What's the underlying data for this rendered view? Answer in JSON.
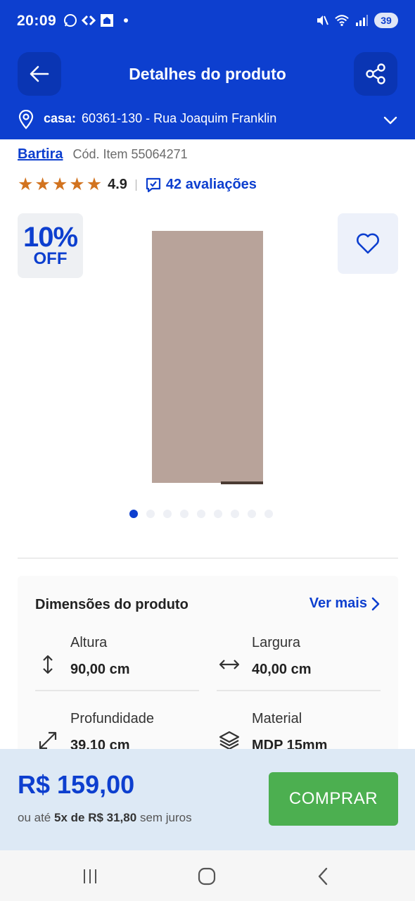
{
  "status_bar": {
    "time": "20:09",
    "battery": "39",
    "icons_left": [
      "whatsapp-icon",
      "carrefour-icon",
      "home-app-icon"
    ],
    "icons_right": [
      "mute-vibrate-icon",
      "wifi-icon",
      "signal-icon",
      "battery-icon"
    ]
  },
  "header": {
    "title": "Detalhes do produto",
    "back_icon": "arrow-left-icon",
    "share_icon": "share-icon"
  },
  "address": {
    "label": "casa:",
    "value": "60361-130 - Rua Joaquim Franklin"
  },
  "product": {
    "brand": "Bartira",
    "item_code": "Cód. Item 55064271",
    "rating": "4.9",
    "stars": 5,
    "reviews": "42 avaliações",
    "discount_pct": "10%",
    "discount_off": "OFF",
    "image_count": 9,
    "image_active": 1,
    "colors": {
      "accent": "#0d3fcf",
      "product": "#b8a39a",
      "buy": "#4caf50",
      "star": "#d2731f"
    }
  },
  "dimensions": {
    "title": "Dimensões do produto",
    "see_more": "Ver mais",
    "items": [
      {
        "label": "Altura",
        "value": "90,00 cm",
        "icon": "height-arrows-icon"
      },
      {
        "label": "Largura",
        "value": "40,00 cm",
        "icon": "width-arrows-icon"
      },
      {
        "label": "Profundidade",
        "value": "39,10 cm",
        "icon": "depth-arrows-icon"
      },
      {
        "label": "Material",
        "value": "MDP 15mm",
        "icon": "layers-icon"
      }
    ]
  },
  "purchase": {
    "price": "R$ 159,00",
    "installments_prefix": "ou até",
    "installments_value": "5x de R$ 31,80",
    "installments_suffix": "sem juros",
    "buy_label": "COMPRAR"
  },
  "nav": {
    "recent": "recent-apps-icon",
    "home": "home-icon",
    "back": "back-icon"
  }
}
